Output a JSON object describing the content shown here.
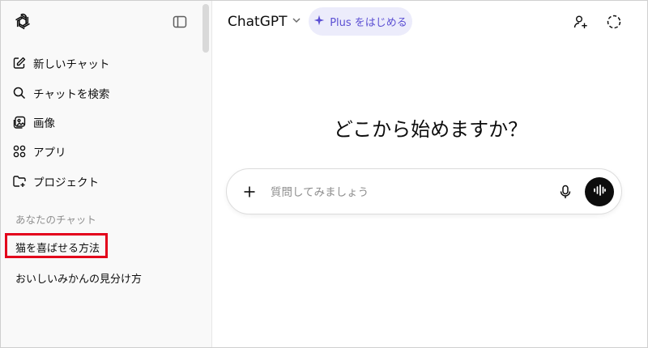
{
  "sidebar": {
    "logo_icon": "openai-logo-icon",
    "toggle_icon": "sidebar-toggle-icon",
    "nav": [
      {
        "label": "新しいチャット",
        "icon": "new-chat-icon"
      },
      {
        "label": "チャットを検索",
        "icon": "search-icon"
      },
      {
        "label": "画像",
        "icon": "image-icon"
      },
      {
        "label": "アプリ",
        "icon": "apps-icon"
      },
      {
        "label": "プロジェクト",
        "icon": "project-folder-icon"
      }
    ],
    "section_label": "あなたのチャット",
    "chats": [
      {
        "label": "猫を喜ばせる方法"
      },
      {
        "label": "おいしいみかんの見分け方"
      }
    ]
  },
  "header": {
    "model_label": "ChatGPT",
    "plus_label": "Plus をはじめる",
    "accent": "#5b4fd3"
  },
  "main": {
    "headline": "どこから始めますか？",
    "composer": {
      "placeholder": "質問してみましょう"
    }
  },
  "colors": {
    "highlight": "#e3001b",
    "sidebar_bg": "#f9f9f9"
  }
}
